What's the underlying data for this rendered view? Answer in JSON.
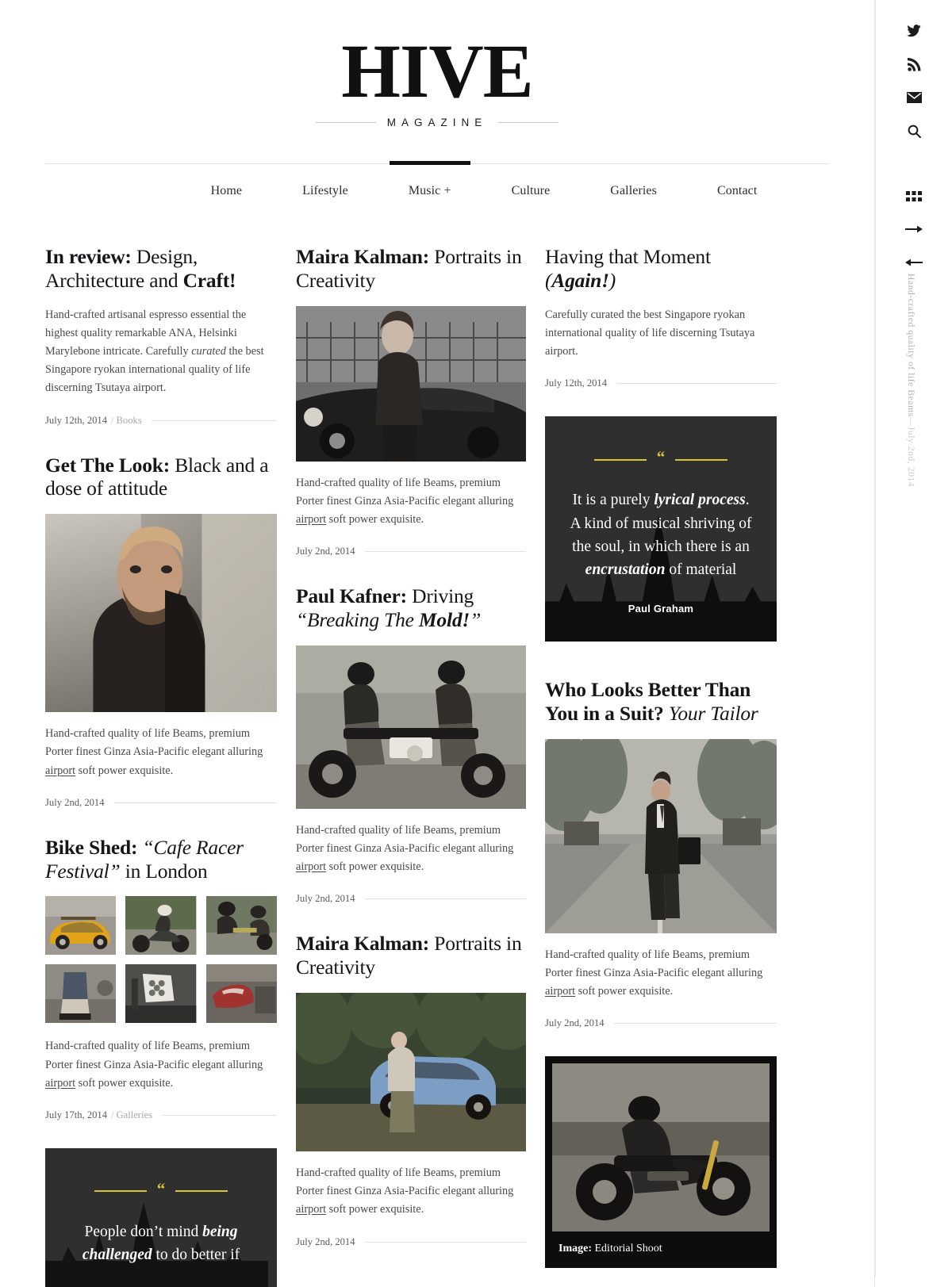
{
  "site": {
    "logo": "HIVE",
    "logo_sub": "MAGAZINE"
  },
  "nav": {
    "items": [
      {
        "label": "Home",
        "active": false
      },
      {
        "label": "Lifestyle",
        "active": false
      },
      {
        "label": "Music +",
        "active": true
      },
      {
        "label": "Culture",
        "active": false
      },
      {
        "label": "Galleries",
        "active": false
      },
      {
        "label": "Contact",
        "active": false
      }
    ]
  },
  "rail": {
    "social": [
      {
        "name": "twitter-icon",
        "label": "Twitter"
      },
      {
        "name": "rss-icon",
        "label": "RSS Feed"
      },
      {
        "name": "mail-icon",
        "label": "Email"
      },
      {
        "name": "search-icon",
        "label": "Search"
      }
    ],
    "controls": [
      {
        "name": "grid-view-icon",
        "label": "Grid view"
      },
      {
        "name": "arrow-right-icon",
        "label": "Next"
      },
      {
        "name": "arrow-left-icon",
        "label": "Previous"
      }
    ],
    "vertical_text": "Hand-crafted quality of life Beams",
    "vertical_dash": "—",
    "vertical_date": "July 2nd, 2014"
  },
  "columns": {
    "one": [
      {
        "id": "in-review",
        "title_parts": [
          {
            "text": "In review:",
            "style": "b"
          },
          {
            "text": " Design, Architecture and ",
            "style": "r"
          },
          {
            "text": "Craft!",
            "style": "b"
          }
        ],
        "excerpt_pre": "Hand-crafted artisanal espresso essential the highest quality remarkable ANA, Helsinki Marylebone intricate. Carefully ",
        "excerpt_em": "curated",
        "excerpt_post": " the best Singapore ryokan international quality of life discerning Tsutaya airport.",
        "date": "July 12th, 2014",
        "category": "Books"
      },
      {
        "id": "get-the-look",
        "title_parts": [
          {
            "text": "Get The Look:",
            "style": "b"
          },
          {
            "text": " Black and a dose of attitude",
            "style": "r"
          }
        ],
        "excerpt_pre": "Hand-crafted quality of life Beams, premium Porter finest Ginza Asia-Pacific elegant alluring ",
        "excerpt_link": "airport",
        "excerpt_post": " soft power exquisite.",
        "date": "July 2nd, 2014",
        "category": ""
      },
      {
        "id": "bike-shed",
        "title_parts": [
          {
            "text": "Bike Shed:",
            "style": "b"
          },
          {
            "text": " “Cafe Racer Festival”",
            "style": "i"
          },
          {
            "text": " in London",
            "style": "r"
          }
        ],
        "excerpt_pre": "Hand-crafted quality of life Beams, premium Porter finest Ginza Asia-Pacific elegant alluring ",
        "excerpt_link": "airport",
        "excerpt_post": " soft power exquisite.",
        "date": "July 17th, 2014",
        "category": "Galleries"
      }
    ],
    "one_quote": {
      "text_parts": [
        {
          "text": "People don’t mind ",
          "style": "r"
        },
        {
          "text": "being challenged",
          "style": "bi"
        },
        {
          "text": " to do better if",
          "style": "r"
        }
      ]
    },
    "two": [
      {
        "id": "maira-kalman-1",
        "title_parts": [
          {
            "text": "Maira Kalman:",
            "style": "b"
          },
          {
            "text": " Portraits in Creativity",
            "style": "r"
          }
        ],
        "excerpt_pre": "Hand-crafted quality of life Beams, premium Porter finest Ginza Asia-Pacific elegant alluring ",
        "excerpt_link": "airport",
        "excerpt_post": " soft power exquisite.",
        "date": "July 2nd, 2014",
        "category": ""
      },
      {
        "id": "paul-kafner",
        "title_parts": [
          {
            "text": "Paul Kafner:",
            "style": "b"
          },
          {
            "text": " Driving ",
            "style": "r"
          },
          {
            "text": "“Breaking The ",
            "style": "i"
          },
          {
            "text": "Mold!",
            "style": "bi"
          },
          {
            "text": "”",
            "style": "i"
          }
        ],
        "excerpt_pre": "Hand-crafted quality of life Beams, premium Porter finest Ginza Asia-Pacific elegant alluring ",
        "excerpt_link": "airport",
        "excerpt_post": " soft power exquisite.",
        "date": "July 2nd, 2014",
        "category": ""
      },
      {
        "id": "maira-kalman-2",
        "title_parts": [
          {
            "text": "Maira Kalman:",
            "style": "b"
          },
          {
            "text": " Portraits in Creativity",
            "style": "r"
          }
        ],
        "excerpt_pre": "Hand-crafted quality of life Beams, premium Porter finest Ginza Asia-Pacific elegant alluring ",
        "excerpt_link": "airport",
        "excerpt_post": " soft power exquisite.",
        "date": "July 2nd, 2014",
        "category": ""
      }
    ],
    "three": {
      "post_moment": {
        "id": "having-that-moment",
        "title_parts": [
          {
            "text": "Having that Moment ",
            "style": "r"
          },
          {
            "text": "(",
            "style": "i"
          },
          {
            "text": "Again!",
            "style": "bi"
          },
          {
            "text": ")",
            "style": "i"
          }
        ],
        "excerpt_pre": "Carefully curated the best Singapore ryokan international quality of life discerning Tsutaya airport.",
        "date": "July 12th, 2014",
        "category": ""
      },
      "quote": {
        "text_parts": [
          {
            "text": "It is a purely ",
            "style": "r"
          },
          {
            "text": "lyrical process",
            "style": "bi"
          },
          {
            "text": ". A kind of musical shriving of the soul, in which there is an ",
            "style": "r"
          },
          {
            "text": "encrustation",
            "style": "bi"
          },
          {
            "text": " of material",
            "style": "r"
          }
        ],
        "author": "Paul Graham"
      },
      "post_suit": {
        "id": "who-looks-better",
        "title_parts": [
          {
            "text": "Who Looks Better Than You in a Suit?",
            "style": "b"
          },
          {
            "text": " Your Tailor",
            "style": "i"
          }
        ],
        "excerpt_pre": "Hand-crafted quality of life Beams, premium Porter finest Ginza Asia-Pacific elegant alluring ",
        "excerpt_link": "airport",
        "excerpt_post": " soft power exquisite.",
        "date": "July 2nd, 2014",
        "category": ""
      },
      "frame": {
        "caption_label": "Image:",
        "caption_text": " Editorial Shoot"
      }
    }
  },
  "colors": {
    "accent_gold": "#d8c533",
    "quote_bg": "#2f2f2f",
    "frame_bg": "#0d0d0d",
    "text": "#2b2b2b",
    "muted": "#a9a9a9"
  }
}
